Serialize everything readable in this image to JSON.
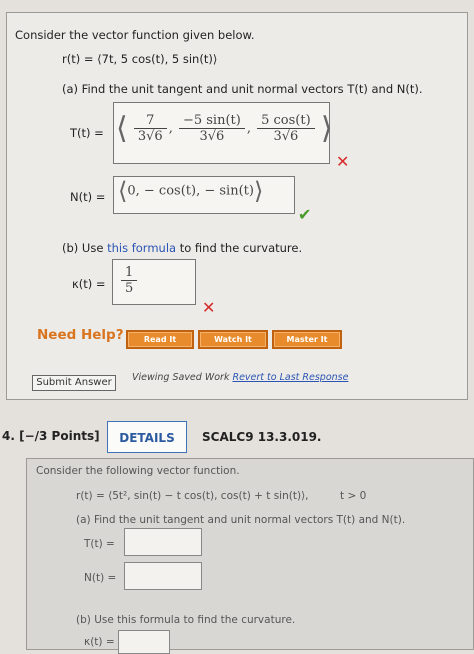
{
  "intro": "Consider the vector function given below.",
  "r_def": "r(t) = ⟨7t, 5 cos(t), 5 sin(t)⟩",
  "part_a": "(a) Find the unit tangent and unit normal vectors T(t) and N(t).",
  "T_label": "T(t) =",
  "T_comp": [
    {
      "num": "7",
      "den": "3√6"
    },
    {
      "num": "−5 sin(t)",
      "den": "3√6"
    },
    {
      "num": "5 cos(t)",
      "den": "3√6"
    }
  ],
  "N_label": "N(t) =",
  "N_value": "0, − cos(t), − sin(t)",
  "part_b_prefix": "(b) Use ",
  "part_b_link": "this formula",
  "part_b_suffix": " to find the curvature.",
  "kappa_label": "κ(t) =",
  "kappa_num": "1",
  "kappa_den": "5",
  "need_help": "Need Help?",
  "btn_read": "Read It",
  "btn_watch": "Watch It",
  "btn_master": "Master It",
  "submit": "Submit Answer",
  "viewing_prefix": "Viewing Saved Work ",
  "revert": "Revert to Last Response",
  "q4_label": "4. [−/3 Points]",
  "details": "DETAILS",
  "code": "SCALC9 13.3.019.",
  "intro2": "Consider the following vector function.",
  "r2_def": "r(t) = ⟨5t², sin(t) − t cos(t), cos(t) + t sin(t)⟩,",
  "r2_cond": "t > 0",
  "part2_a": "(a) Find the unit tangent and unit normal vectors T(t) and N(t).",
  "T2_label": "T(t) =",
  "N2_label": "N(t) =",
  "part2_b": "(b) Use this formula to find the curvature.",
  "kappa2_label": "κ(t) =",
  "colors": {
    "orange": "#e88b2c",
    "link": "#2b55b3",
    "wrong": "#d62b2b",
    "right": "#4a9a2a"
  },
  "icons": {
    "wrong": "x-mark-icon",
    "right": "check-mark-icon"
  }
}
